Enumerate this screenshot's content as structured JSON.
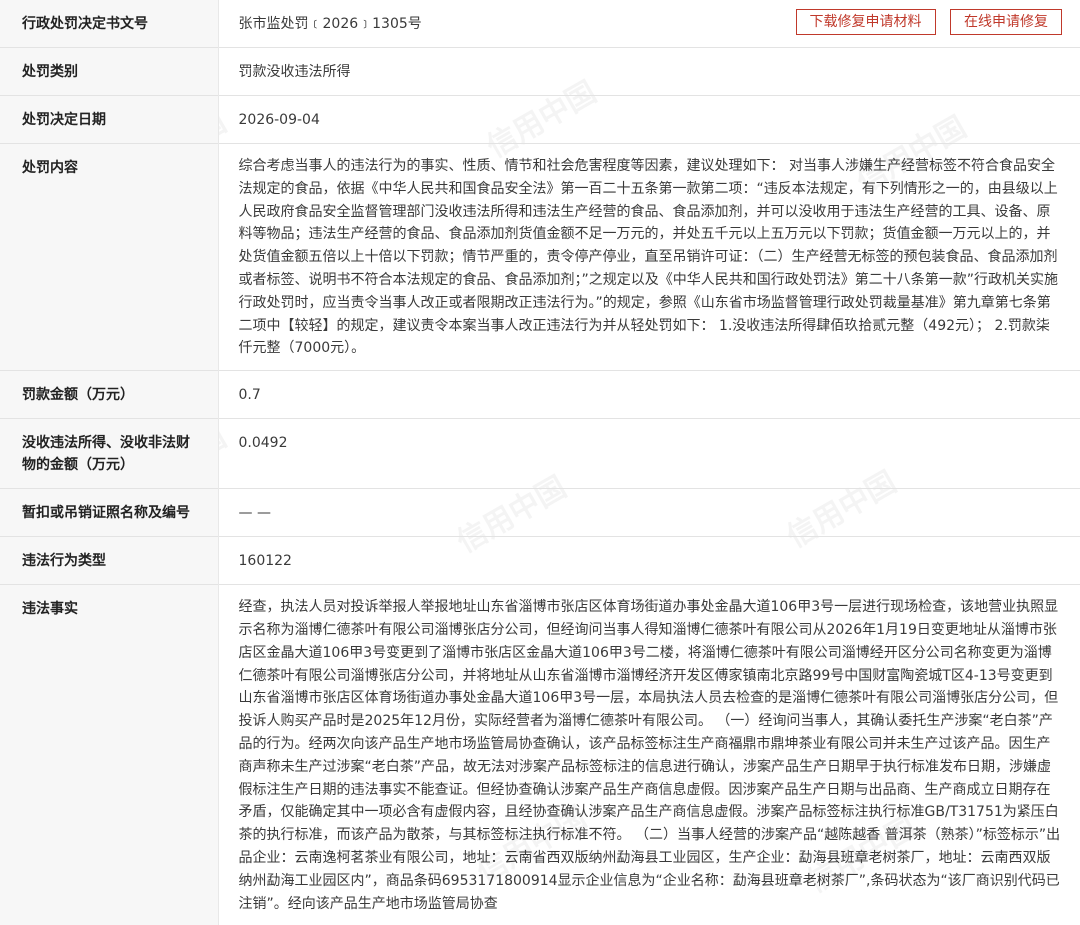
{
  "rows": {
    "doc_no": {
      "label": "行政处罚决定书文号",
      "value": "张市监处罚﹝2026﹞1305号"
    },
    "category": {
      "label": "处罚类别",
      "value": "罚款没收违法所得"
    },
    "date": {
      "label": "处罚决定日期",
      "value": "2026-09-04"
    },
    "content": {
      "label": "处罚内容",
      "value": "综合考虑当事人的违法行为的事实、性质、情节和社会危害程度等因素，建议处理如下： 对当事人涉嫌生产经营标签不符合食品安全法规定的食品，依据《中华人民共和国食品安全法》第一百二十五条第一款第二项：“违反本法规定，有下列情形之一的，由县级以上人民政府食品安全监督管理部门没收违法所得和违法生产经营的食品、食品添加剂，并可以没收用于违法生产经营的工具、设备、原料等物品；违法生产经营的食品、食品添加剂货值金额不足一万元的，并处五千元以上五万元以下罚款；货值金额一万元以上的，并处货值金额五倍以上十倍以下罚款；情节严重的，责令停产停业，直至吊销许可证：（二）生产经营无标签的预包装食品、食品添加剂或者标签、说明书不符合本法规定的食品、食品添加剂；”之规定以及《中华人民共和国行政处罚法》第二十八条第一款”行政机关实施行政处罚时，应当责令当事人改正或者限期改正违法行为。”的规定，参照《山东省市场监督管理行政处罚裁量基准》第九章第七条第二项中【较轻】的规定，建议责令本案当事人改正违法行为并从轻处罚如下： 1.没收违法所得肆佰玖拾贰元整（492元）； 2.罚款柒仟元整（7000元）。"
    },
    "fine": {
      "label": "罚款金额（万元）",
      "value": "0.7"
    },
    "confisc": {
      "label": "没收违法所得、没收非法财物的金额（万元）",
      "value": "0.0492"
    },
    "license": {
      "label": "暂扣或吊销证照名称及编号",
      "value": "— —"
    },
    "type": {
      "label": "违法行为类型",
      "value": "160122"
    },
    "facts": {
      "label": "违法事实",
      "value": "经查，执法人员对投诉举报人举报地址山东省淄博市张店区体育场街道办事处金晶大道106甲3号一层进行现场检查，该地营业执照显示名称为淄博仁德茶叶有限公司淄博张店分公司，但经询问当事人得知淄博仁德茶叶有限公司从2026年1月19日变更地址从淄博市张店区金晶大道106甲3号变更到了淄博市张店区金晶大道106甲3号二楼，将淄博仁德茶叶有限公司淄博经开区分公司名称变更为淄博仁德茶叶有限公司淄博张店分公司，并将地址从山东省淄博市淄博经济开发区傅家镇南北京路99号中国财富陶瓷城T区4-13号变更到山东省淄博市张店区体育场街道办事处金晶大道106甲3号一层，本局执法人员去检查的是淄博仁德茶叶有限公司淄博张店分公司，但投诉人购买产品时是2025年12月份，实际经营者为淄博仁德茶叶有限公司。 （一）经询问当事人，其确认委托生产涉案“老白茶”产品的行为。经两次向该产品生产地市场监管局协查确认，该产品标签标注生产商福鼎市鼎坤茶业有限公司并未生产过该产品。因生产商声称未生产过涉案“老白茶”产品，故无法对涉案产品标签标注的信息进行确认，涉案产品生产日期早于执行标准发布日期，涉嫌虚假标注生产日期的违法事实不能查证。但经协查确认涉案产品生产商信息虚假。因涉案产品生产日期与出品商、生产商成立日期存在矛盾，仅能确定其中一项必含有虚假内容，且经协查确认涉案产品生产商信息虚假。涉案产品标签标注执行标准GB/T31751为紧压白茶的执行标准，而该产品为散茶，与其标签标注执行标准不符。 （二）当事人经营的涉案产品“越陈越香 普洱茶（熟茶）”标签标示”出品企业：云南逸柯茗茶业有限公司，地址：云南省西双版纳州勐海县工业园区，生产企业：勐海县班章老树茶厂，地址：云南西双版纳州勐海工业园区内”，商品条码6953171800914显示企业信息为“企业名称：勐海县班章老树茶厂”,条码状态为“该厂商识别代码已注销”。经向该产品生产地市场监管局协查"
    }
  },
  "buttons": {
    "download": "下载修复申请材料",
    "repair": "在线申请修复"
  },
  "watermark": "信用中国"
}
